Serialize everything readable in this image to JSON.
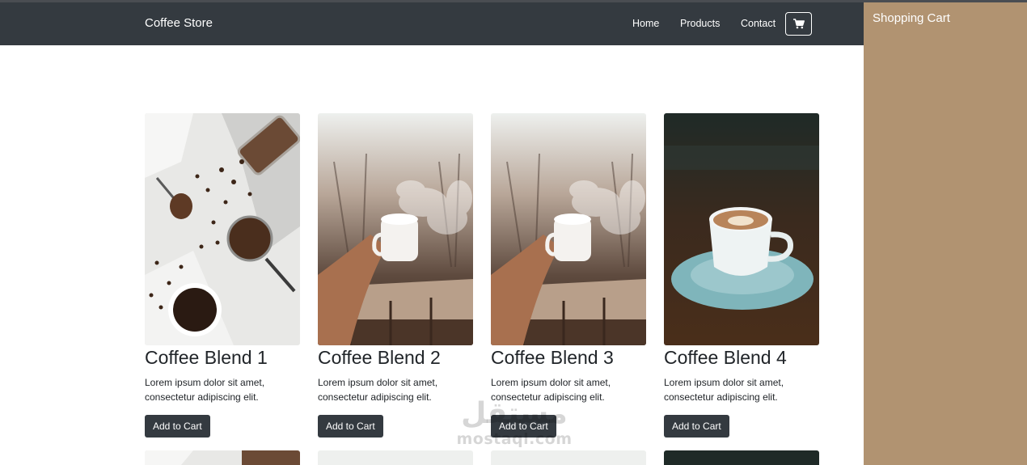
{
  "navbar": {
    "brand": "Coffee Store",
    "links": [
      "Home",
      "Products",
      "Contact"
    ],
    "cart_icon": "shopping-cart-icon"
  },
  "cart_panel": {
    "title": "Shopping Cart"
  },
  "products": [
    {
      "title": "Coffee Blend 1",
      "description": "Lorem ipsum dolor sit amet, consectetur adipiscing elit.",
      "button": "Add to Cart",
      "image": "coffee-beans-flatlay-photo"
    },
    {
      "title": "Coffee Blend 2",
      "description": "Lorem ipsum dolor sit amet, consectetur adipiscing elit.",
      "button": "Add to Cart",
      "image": "hand-holding-steaming-cup-photo"
    },
    {
      "title": "Coffee Blend 3",
      "description": "Lorem ipsum dolor sit amet, consectetur adipiscing elit.",
      "button": "Add to Cart",
      "image": "hand-holding-steaming-cup-photo"
    },
    {
      "title": "Coffee Blend 4",
      "description": "Lorem ipsum dolor sit amet, consectetur adipiscing elit.",
      "button": "Add to Cart",
      "image": "cappuccino-cup-saucer-photo"
    }
  ],
  "watermark": {
    "arabic": "مستقل",
    "latin": "mostaql.com"
  },
  "colors": {
    "navbar": "#343a40",
    "cart_panel": "#b19371",
    "button": "#343a40"
  }
}
